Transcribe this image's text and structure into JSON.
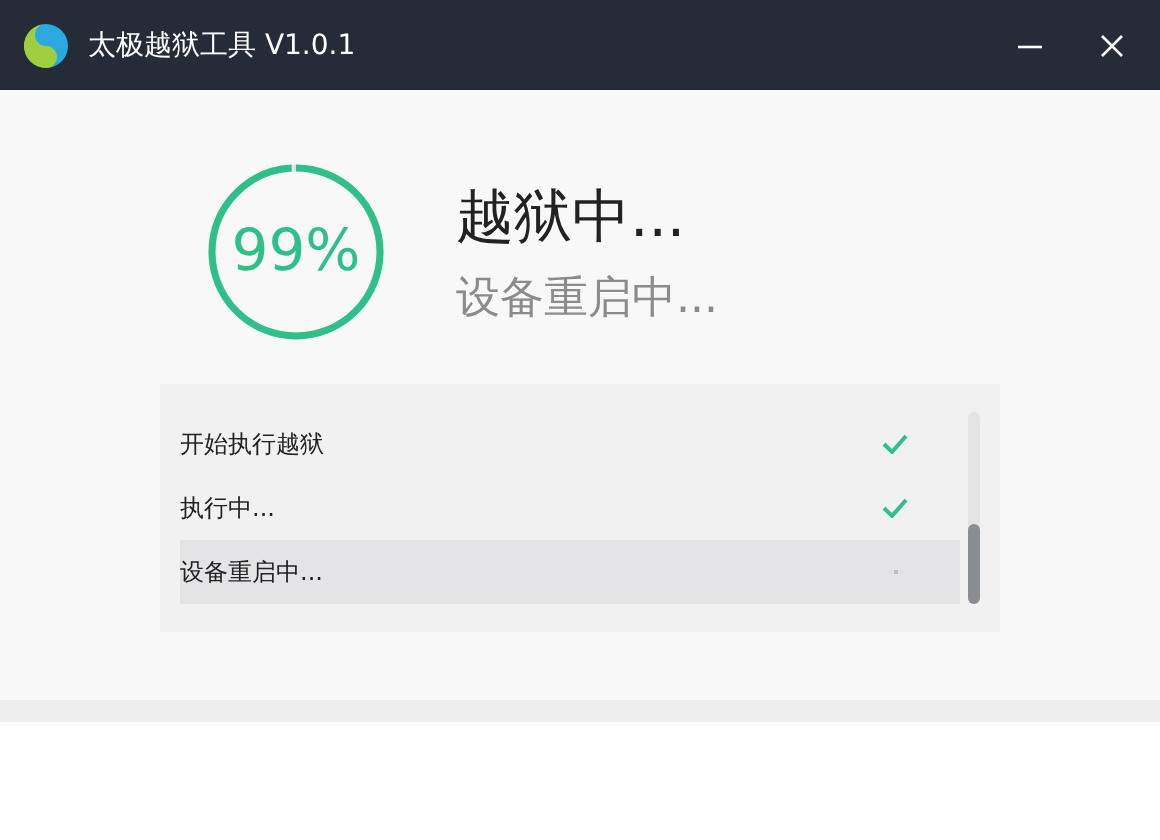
{
  "window": {
    "title": "太极越狱工具 V1.0.1"
  },
  "progress": {
    "percent": "99%"
  },
  "status": {
    "title": "越狱中...",
    "subtitle": "设备重启中..."
  },
  "steps": [
    {
      "label": "开始执行越狱",
      "done": true,
      "selected": false
    },
    {
      "label": "执行中...",
      "done": true,
      "selected": false
    },
    {
      "label": "设备重启中...",
      "done": false,
      "selected": true
    }
  ]
}
